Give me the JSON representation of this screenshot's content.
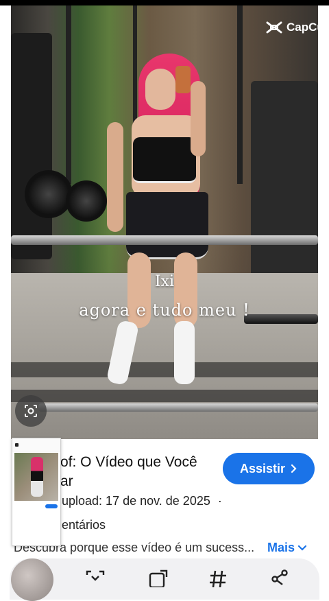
{
  "video": {
    "logo_text": "CapCut",
    "caption_line1": "Ixi",
    "caption_line2": "agora e tudo meu !"
  },
  "info": {
    "title": "of: O Vídeo que Você\nar",
    "watch_label": "Assistir",
    "upload_text": "upload: 17 de nov. de 2025",
    "upload_separator": "·",
    "comments_text": "entários",
    "description": "Descubra porque esse vídeo é um sucess...",
    "more_label": "Mais"
  },
  "colors": {
    "accent": "#1a73e8",
    "hair": "#e8366c"
  },
  "icons": [
    "capcut-logo-icon",
    "lens-icon",
    "chevron-right-icon",
    "chevron-down-icon",
    "download-icon",
    "remix-icon",
    "hashtag-icon",
    "share-icon"
  ]
}
